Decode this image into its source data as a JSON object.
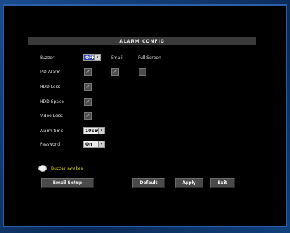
{
  "title": "ALARM CONFIG",
  "rows": {
    "buzzer": {
      "label": "Buzzer",
      "value": "OFF",
      "arrow": "▾"
    },
    "email": {
      "label": "Email"
    },
    "full_screen": {
      "label": "Full Screen"
    },
    "md_alarm": {
      "label": "MD Alarm"
    },
    "hdd_loss": {
      "label": "HDD Loss"
    },
    "hdd_space": {
      "label": "HDD Space"
    },
    "video_loss": {
      "label": "Video Loss"
    },
    "alarm_time": {
      "label": "Alarm time",
      "value": "10SEC",
      "arrow": "▾"
    },
    "password": {
      "label": "Password",
      "value": "On",
      "arrow": "▾"
    }
  },
  "checkboxes": {
    "md_alarm": true,
    "md_alarm_email": true,
    "md_alarm_fullscreen": false,
    "hdd_loss": true,
    "hdd_space": true,
    "video_loss": true
  },
  "check_glyph": "✓",
  "status": {
    "icon": "buzzer-icon",
    "text": "Buzzer awaken"
  },
  "buttons": {
    "email_setup": "Email Setup",
    "default": "Default",
    "apply": "Apply",
    "exit": "Exit"
  },
  "colors": {
    "frame": "#0f3a74",
    "background": "#000000",
    "titlebar": "#3a3a3a",
    "selected": "#2f3fbf",
    "status_text": "#d8d200"
  }
}
